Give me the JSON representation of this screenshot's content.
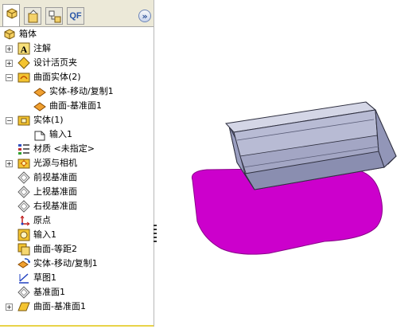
{
  "tabs": {
    "feature_manager": "feature-manager-icon",
    "property_manager": "property-manager-icon",
    "configuration_manager": "configuration-manager-icon",
    "qf_label": "QF",
    "collapse_glyph": "»"
  },
  "tree": {
    "root": "箱体",
    "items": [
      {
        "label": "注解",
        "icon": "annotations-icon"
      },
      {
        "label": "设计活页夹",
        "icon": "design-binder-icon"
      },
      {
        "label": "曲面实体(2)",
        "icon": "surface-bodies-folder-icon"
      },
      {
        "label": "实体-移动/复制1",
        "icon": "surface-body-icon"
      },
      {
        "label": "曲面-基准面1",
        "icon": "surface-body-icon"
      },
      {
        "label": "实体(1)",
        "icon": "solid-bodies-folder-icon"
      },
      {
        "label": "输入1",
        "icon": "imported-body-icon"
      },
      {
        "label": "材质 <未指定>",
        "icon": "material-icon"
      },
      {
        "label": "光源与相机",
        "icon": "lights-cameras-icon"
      },
      {
        "label": "前视基准面",
        "icon": "plane-icon"
      },
      {
        "label": "上视基准面",
        "icon": "plane-icon"
      },
      {
        "label": "右视基准面",
        "icon": "plane-icon"
      },
      {
        "label": "原点",
        "icon": "origin-icon"
      },
      {
        "label": "输入1",
        "icon": "import-feature-icon"
      },
      {
        "label": "曲面-等距2",
        "icon": "offset-surface-icon"
      },
      {
        "label": "实体-移动/复制1",
        "icon": "move-copy-icon"
      },
      {
        "label": "草图1",
        "icon": "sketch-icon"
      },
      {
        "label": "基准面1",
        "icon": "plane-icon"
      },
      {
        "label": "曲面-基准面1",
        "icon": "planar-surface-icon"
      }
    ]
  },
  "colors": {
    "tray_body": "#8f93b4",
    "tray_highlight": "#c4c7dc",
    "planar_surface": "#cc00cc",
    "folder_yellow": "#f4c430",
    "plane_icon": "#606060"
  }
}
